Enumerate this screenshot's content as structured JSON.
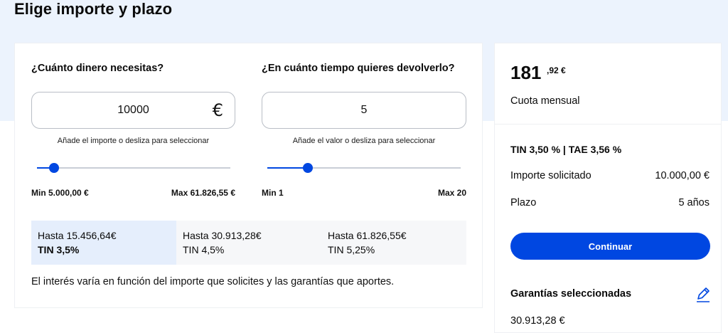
{
  "page": {
    "title": "Elige importe y plazo"
  },
  "amount": {
    "question": "¿Cuánto dinero necesitas?",
    "value": "10000",
    "currency_icon": "euro-icon",
    "hint": "Añade el importe o desliza para seleccionar",
    "min_label": "Min 5.000,00 €",
    "max_label": "Max 61.826,55 €",
    "slider_fraction": 0.09
  },
  "term": {
    "question": "¿En cuánto tiempo quieres devolverlo?",
    "value": "5",
    "hint": "Añade el valor o desliza para seleccionar",
    "min_label": "Min 1",
    "max_label": "Max 20",
    "slider_fraction": 0.21
  },
  "tiers": [
    {
      "limit": "Hasta 15.456,64€",
      "rate": "TIN 3,5%",
      "active": true
    },
    {
      "limit": "Hasta 30.913,28€",
      "rate": "TIN 4,5%",
      "active": false
    },
    {
      "limit": "Hasta 61.826,55€",
      "rate": "TIN 5,25%",
      "active": false
    }
  ],
  "note": "El interés varía en función del importe que solicites y las garantías que aportes.",
  "summary": {
    "quota_int": "181",
    "quota_dec": ",92 €",
    "quota_label": "Cuota mensual",
    "rates": "TIN 3,50 % | TAE 3,56 %",
    "amount_label": "Importe solicitado",
    "amount_value": "10.000,00 €",
    "term_label": "Plazo",
    "term_value": "5 años",
    "continue_label": "Continuar",
    "guarantees_title": "Garantías seleccionadas",
    "edit_icon": "pencil-icon",
    "guarantees_value": "30.913,28 €"
  },
  "colors": {
    "accent": "#0047e1",
    "band": "#ecf3fd",
    "tier_active": "#e5eefc"
  }
}
